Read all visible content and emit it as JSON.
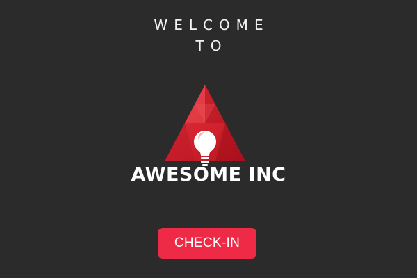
{
  "welcome": {
    "line1": "WELCOME",
    "line2": "TO"
  },
  "logo": {
    "company_name": "AWESOME INC",
    "icon": "lightbulb-icon",
    "triangle_color": "#d3212d"
  },
  "checkin_button": {
    "label": "CHECK-IN",
    "color": "#ef2a47"
  },
  "colors": {
    "background": "#2b2b2b",
    "text": "#ffffff"
  }
}
